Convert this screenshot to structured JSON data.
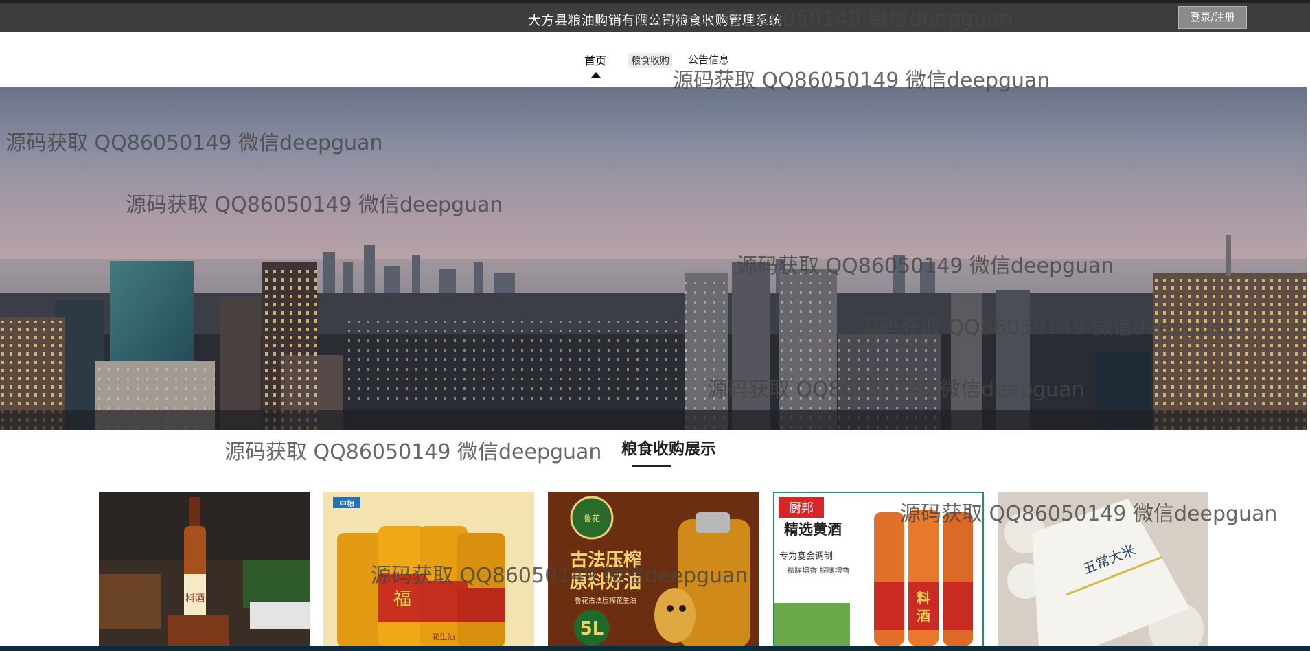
{
  "header": {
    "title": "大方县粮油购销有限公司粮食收购管理系统",
    "login_button": "登录/注册"
  },
  "nav": {
    "items": [
      {
        "label": "首页",
        "active": true
      },
      {
        "label": "粮食收购",
        "active": false
      },
      {
        "label": "公告信息",
        "active": false
      }
    ]
  },
  "section": {
    "title": "粮食收购展示"
  },
  "products": [
    {
      "label": "料酒",
      "brand": ""
    },
    {
      "label": "福",
      "brand": "中粮"
    },
    {
      "label": "古法压榨 原料好油",
      "brand": ""
    },
    {
      "label": "精选黄酒",
      "brand": "厨邦"
    },
    {
      "label": "五常大米",
      "brand": ""
    }
  ],
  "product_texts": {
    "p1_label": "料酒",
    "p2_brand": "中粮",
    "p2_label": "福",
    "p2_sub": "花生油",
    "p3_top": "鲁花",
    "p3_line1": "古法压榨",
    "p3_line2": "原料好油",
    "p3_line3": "鲁花古法压榨花生油",
    "p3_vol": "5L",
    "p4_brand": "厨邦",
    "p4_title": "精选黄酒",
    "p4_line1": "专为宴会调制",
    "p4_line2": "祛腥增香 提味增香",
    "p4_badge1": "料",
    "p4_badge2": "酒",
    "p5_label": "五常大米"
  },
  "watermark": "源码获取 QQ86050149 微信deepguan",
  "colors": {
    "topbar": "#3d3d3d",
    "accent": "#222222"
  }
}
